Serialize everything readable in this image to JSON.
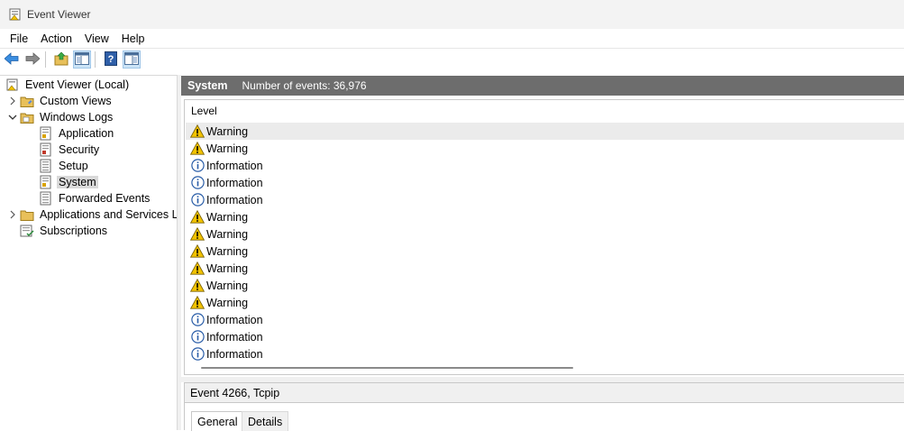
{
  "window": {
    "title": "Event Viewer"
  },
  "menu": [
    "File",
    "Action",
    "View",
    "Help"
  ],
  "toolbar": {
    "buttons": [
      "back-icon",
      "forward-icon",
      "up-folder-icon",
      "show-hide-tree-icon",
      "help-icon",
      "show-hide-action-pane-icon"
    ]
  },
  "tree": {
    "root": "Event Viewer (Local)",
    "custom_views": "Custom Views",
    "windows_logs": "Windows Logs",
    "logs": [
      "Application",
      "Security",
      "Setup",
      "System",
      "Forwarded Events"
    ],
    "selected_log": "System",
    "apps_services": "Applications and Services Lo",
    "subscriptions": "Subscriptions"
  },
  "log_header": {
    "name": "System",
    "count": "Number of events: 36,976"
  },
  "events": {
    "column": "Level",
    "rows": [
      "Warning",
      "Warning",
      "Information",
      "Information",
      "Information",
      "Warning",
      "Warning",
      "Warning",
      "Warning",
      "Warning",
      "Warning",
      "Information",
      "Information",
      "Information"
    ]
  },
  "details": {
    "title": "Event 4266, Tcpip",
    "tabs": [
      "General",
      "Details"
    ],
    "active_tab": "General"
  },
  "colors": {
    "header_bg": "#6d6d6d",
    "warning": "#f3c300",
    "info": "#2b5ea8",
    "selected_row": "#ebebeb"
  }
}
